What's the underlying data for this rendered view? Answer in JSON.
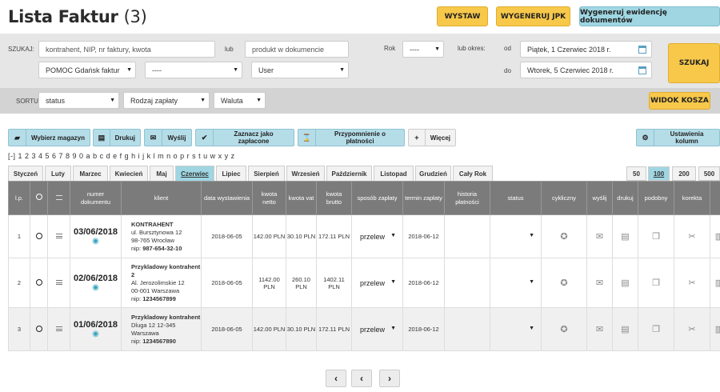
{
  "header": {
    "title": "Lista Faktur",
    "count": "(3)",
    "btn_wystaw": "WYSTAW",
    "btn_jpk": "WYGENERUJ JPK",
    "btn_ewidencja": "Wygeneruj ewidencję dokumentów"
  },
  "search": {
    "szukaj_label": "SZUKAJ:",
    "query_placeholder": "kontrahent, NIP, nr faktury, kwota",
    "lub1": "lub",
    "product_placeholder": "produkt w dokumencie",
    "rok_label": "Rok",
    "rok_value": "----",
    "lub_okres": "lub okres:",
    "od_label": "od",
    "od_value": "Piątek, 1 Czerwiec 2018 r.",
    "do_label": "do",
    "do_value": "Wtorek, 5 Czerwiec 2018 r.",
    "company": "POMOC Gdańsk faktur",
    "filter2": "----",
    "user": "User",
    "szukaj_btn": "SZUKAJ"
  },
  "sort": {
    "label": "SORTUJ:",
    "status": "status",
    "payment": "Rodzaj zapłaty",
    "currency": "Waluta",
    "trash_btn": "WIDOK KOSZA"
  },
  "actions": {
    "warehouse": "Wybierz magazyn",
    "print": "Drukuj",
    "send": "Wyślij",
    "paid": "Zaznacz jako zapłacone",
    "reminder": "Przypomnienie o płatności",
    "more": "Więcej",
    "columns": "Ustawienia kolumn"
  },
  "letters": "[-] 1 2 3 4 5 6 7 8 9 0 a b c d e f g h i j k l m n o p r s t u w x y z",
  "months": [
    "Styczeń",
    "Luty",
    "Marzec",
    "Kwiecień",
    "Maj",
    "Czerwiec",
    "Lipiec",
    "Sierpień",
    "Wrzesień",
    "Październik",
    "Listopad",
    "Grudzień",
    "Cały Rok"
  ],
  "active_month": "Czerwiec",
  "page_sizes": [
    "50",
    "100",
    "200",
    "500"
  ],
  "active_page_size": "100",
  "columns": [
    "l.p.",
    "",
    "",
    "numer dokumentu",
    "klient",
    "data wystawienia",
    "kwota netto",
    "kwota vat",
    "kwota brutto",
    "sposób zapłaty",
    "termin zapłaty",
    "historia płatności",
    "status",
    "cykliczny",
    "wyślij",
    "drukuj",
    "podobny",
    "korekta",
    ""
  ],
  "rows": [
    {
      "lp": "1",
      "doc": "03/06/2018",
      "client_name": "KONTRAHENT",
      "client_addr1": "ul. Bursztynowa 12",
      "client_addr2": "98-765 Wrocław",
      "client_nip_label": "nip:",
      "client_nip": "987-654-32-10",
      "date": "2018-06-05",
      "netto": "142.00 PLN",
      "vat": "30.10 PLN",
      "brutto": "172.11 PLN",
      "payment": "przelew",
      "due": "2018-06-12"
    },
    {
      "lp": "2",
      "doc": "02/06/2018",
      "client_name": "Przykladowy kontrahent 2",
      "client_addr1": "Al. Jerozolimskie 12",
      "client_addr2": "00-001 Warszawa",
      "client_nip_label": "nip:",
      "client_nip": "1234567899",
      "date": "2018-06-05",
      "netto": "1142.00 PLN",
      "vat": "260.10 PLN",
      "brutto": "1402.11 PLN",
      "payment": "przelew",
      "due": "2018-06-12"
    },
    {
      "lp": "3",
      "doc": "01/06/2018",
      "client_name": "Przykladowy kontrahent",
      "client_addr1": "Dluga 12 12-345",
      "client_addr2": "Warszawa",
      "client_nip_label": "nip:",
      "client_nip": "1234567890",
      "date": "2018-06-05",
      "netto": "142.00 PLN",
      "vat": "30.10 PLN",
      "brutto": "172.11 PLN",
      "payment": "przelew",
      "due": "2018-06-12"
    }
  ],
  "pagination": {
    "first": "‹",
    "prev": "‹",
    "next": "›"
  }
}
